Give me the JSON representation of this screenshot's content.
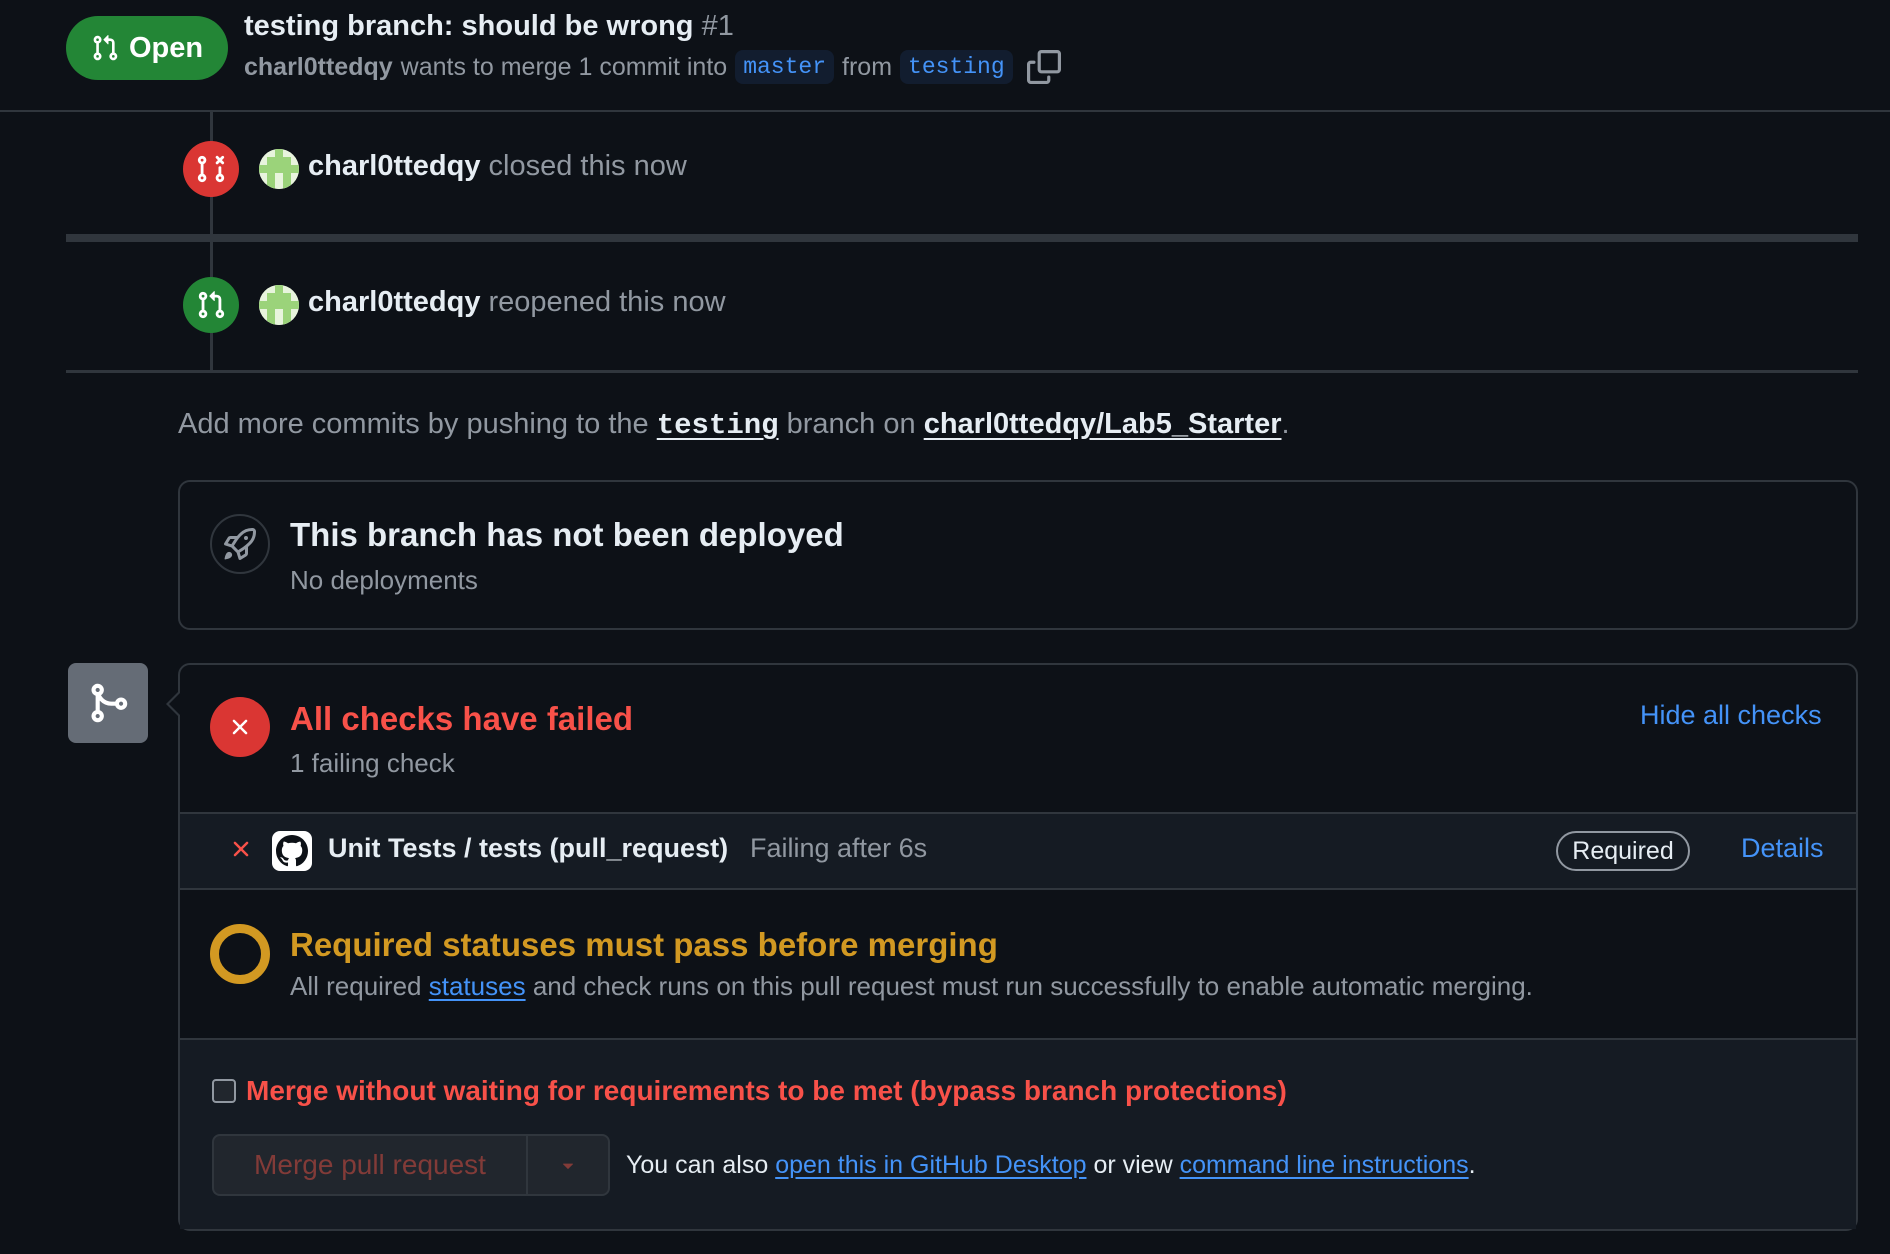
{
  "header": {
    "state_label": "Open",
    "title": "testing branch: should be wrong",
    "number": "#1",
    "author": "charl0ttedqy",
    "merge_text": "wants to merge 1 commit into",
    "base_branch": "master",
    "from_text": "from",
    "head_branch": "testing"
  },
  "timeline": {
    "events": [
      {
        "actor": "charl0ttedqy",
        "action": "closed this now",
        "color": "#da3633"
      },
      {
        "actor": "charl0ttedqy",
        "action": "reopened this now",
        "color": "#238636"
      }
    ],
    "push_hint": {
      "prefix": "Add more commits by pushing to the",
      "branch": "testing",
      "middle": "branch on",
      "repo": "charl0ttedqy/Lab5_Starter",
      "suffix": "."
    }
  },
  "deploy": {
    "title": "This branch has not been deployed",
    "subtitle": "No deployments"
  },
  "checks": {
    "title": "All checks have failed",
    "subtitle": "1 failing check",
    "hide_label": "Hide all checks",
    "rows": [
      {
        "name": "Unit Tests / tests (pull_request)",
        "status": "Failing after 6s",
        "badge": "Required",
        "details": "Details"
      }
    ]
  },
  "requirements": {
    "title": "Required statuses must pass before merging",
    "sub_prefix": "All required",
    "sub_link": "statuses",
    "sub_suffix": "and check runs on this pull request must run successfully to enable automatic merging."
  },
  "merge": {
    "bypass_label": "Merge without waiting for requirements to be met (bypass branch protections)",
    "bypass_checked": false,
    "button_label": "Merge pull request",
    "also_prefix": "You can also",
    "desktop_link": "open this in GitHub Desktop",
    "or_view": "or view",
    "cli_link": "command line instructions",
    "suffix": "."
  },
  "colors": {
    "open_green": "#238636",
    "closed_red": "#da3633",
    "fail_red": "#f85149",
    "pending_yellow": "#d29922",
    "link_blue": "#4493f8"
  }
}
